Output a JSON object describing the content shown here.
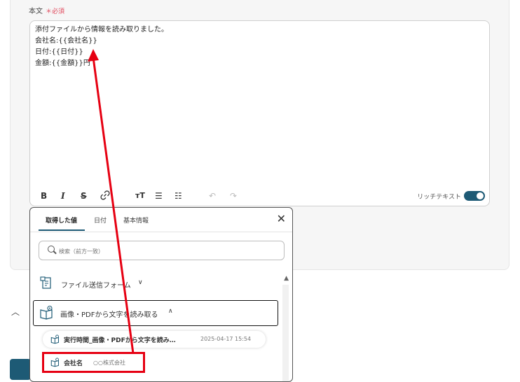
{
  "field": {
    "label": "本文",
    "required": "＊必須"
  },
  "editor": {
    "body": "添付ファイルから情報を読み取りました。\n会社名:{{会社名}}\n日付:{{日付}}\n金額:{{金額}}円",
    "toolbar": {
      "bold": "B",
      "italic": "I",
      "strike": "S",
      "link_icon": "link-icon",
      "text_size": "тT",
      "bullet_list": "☰",
      "ordered_list": "☷",
      "undo": "↶",
      "redo": "↷"
    },
    "rich_text_label": "リッチテキスト",
    "rich_text_enabled": true
  },
  "popup": {
    "tabs": [
      {
        "label": "取得した値",
        "active": true
      },
      {
        "label": "日付",
        "active": false
      },
      {
        "label": "基本情報",
        "active": false
      }
    ],
    "close": "✕",
    "search_placeholder": "検索（前方一致）",
    "groups": [
      {
        "label": "ファイル送信フォーム",
        "chevron": "∨",
        "expanded": false
      },
      {
        "label": "画像・PDFから文字を読み取る",
        "chevron": "∧",
        "expanded": true
      }
    ],
    "sub_item": {
      "label": "実行時間_画像・PDFから文字を読み…",
      "value": "2025-04-17 15:54"
    },
    "value_item": {
      "label": "会社名",
      "value": "○○株式会社"
    }
  },
  "colors": {
    "accent": "#1d5a75",
    "required": "#e0475b",
    "annotation": "#e60012"
  }
}
